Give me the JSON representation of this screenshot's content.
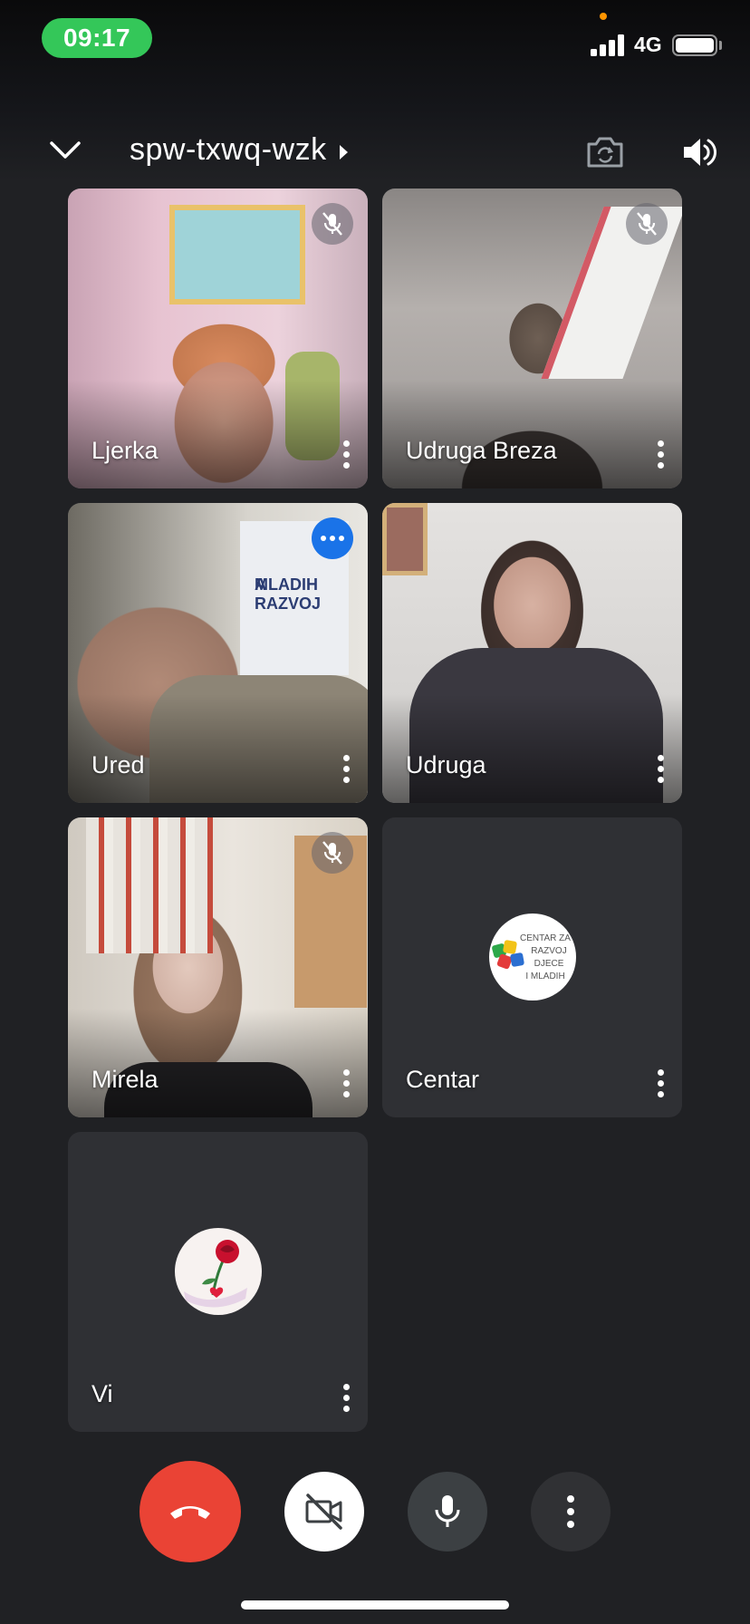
{
  "status_bar": {
    "time": "09:17",
    "network": "4G",
    "time_pill_color": "#34c759",
    "battery_level": 1.0
  },
  "meeting": {
    "code": "spw-txwq-wzk",
    "collapse_icon": "chevron-down-icon",
    "switch_camera_icon": "camera-flip-icon",
    "audio_icon": "speaker-icon"
  },
  "tiles": [
    {
      "name": "Ljerka",
      "muted": true
    },
    {
      "name": "Udruga Breza",
      "muted": true
    },
    {
      "name": "Ured",
      "badge": "more-options"
    },
    {
      "name": "Udruga"
    },
    {
      "name": "Mirela",
      "muted": true
    },
    {
      "name": "Centar",
      "avatar_lines": [
        "CENTAR ZA",
        "RAZVOJ",
        "DJECE",
        "I MLADIH"
      ]
    },
    {
      "name": "Vi",
      "avatar": "rose-icon"
    }
  ],
  "scene_text": {
    "poster_line1": "A RAZVOJ",
    "poster_line2": "MLADIH"
  },
  "controls": {
    "end_call_color": "#ea4335",
    "camera": "camera-off-icon",
    "microphone": "microphone-icon",
    "more": "more-vertical-icon"
  }
}
